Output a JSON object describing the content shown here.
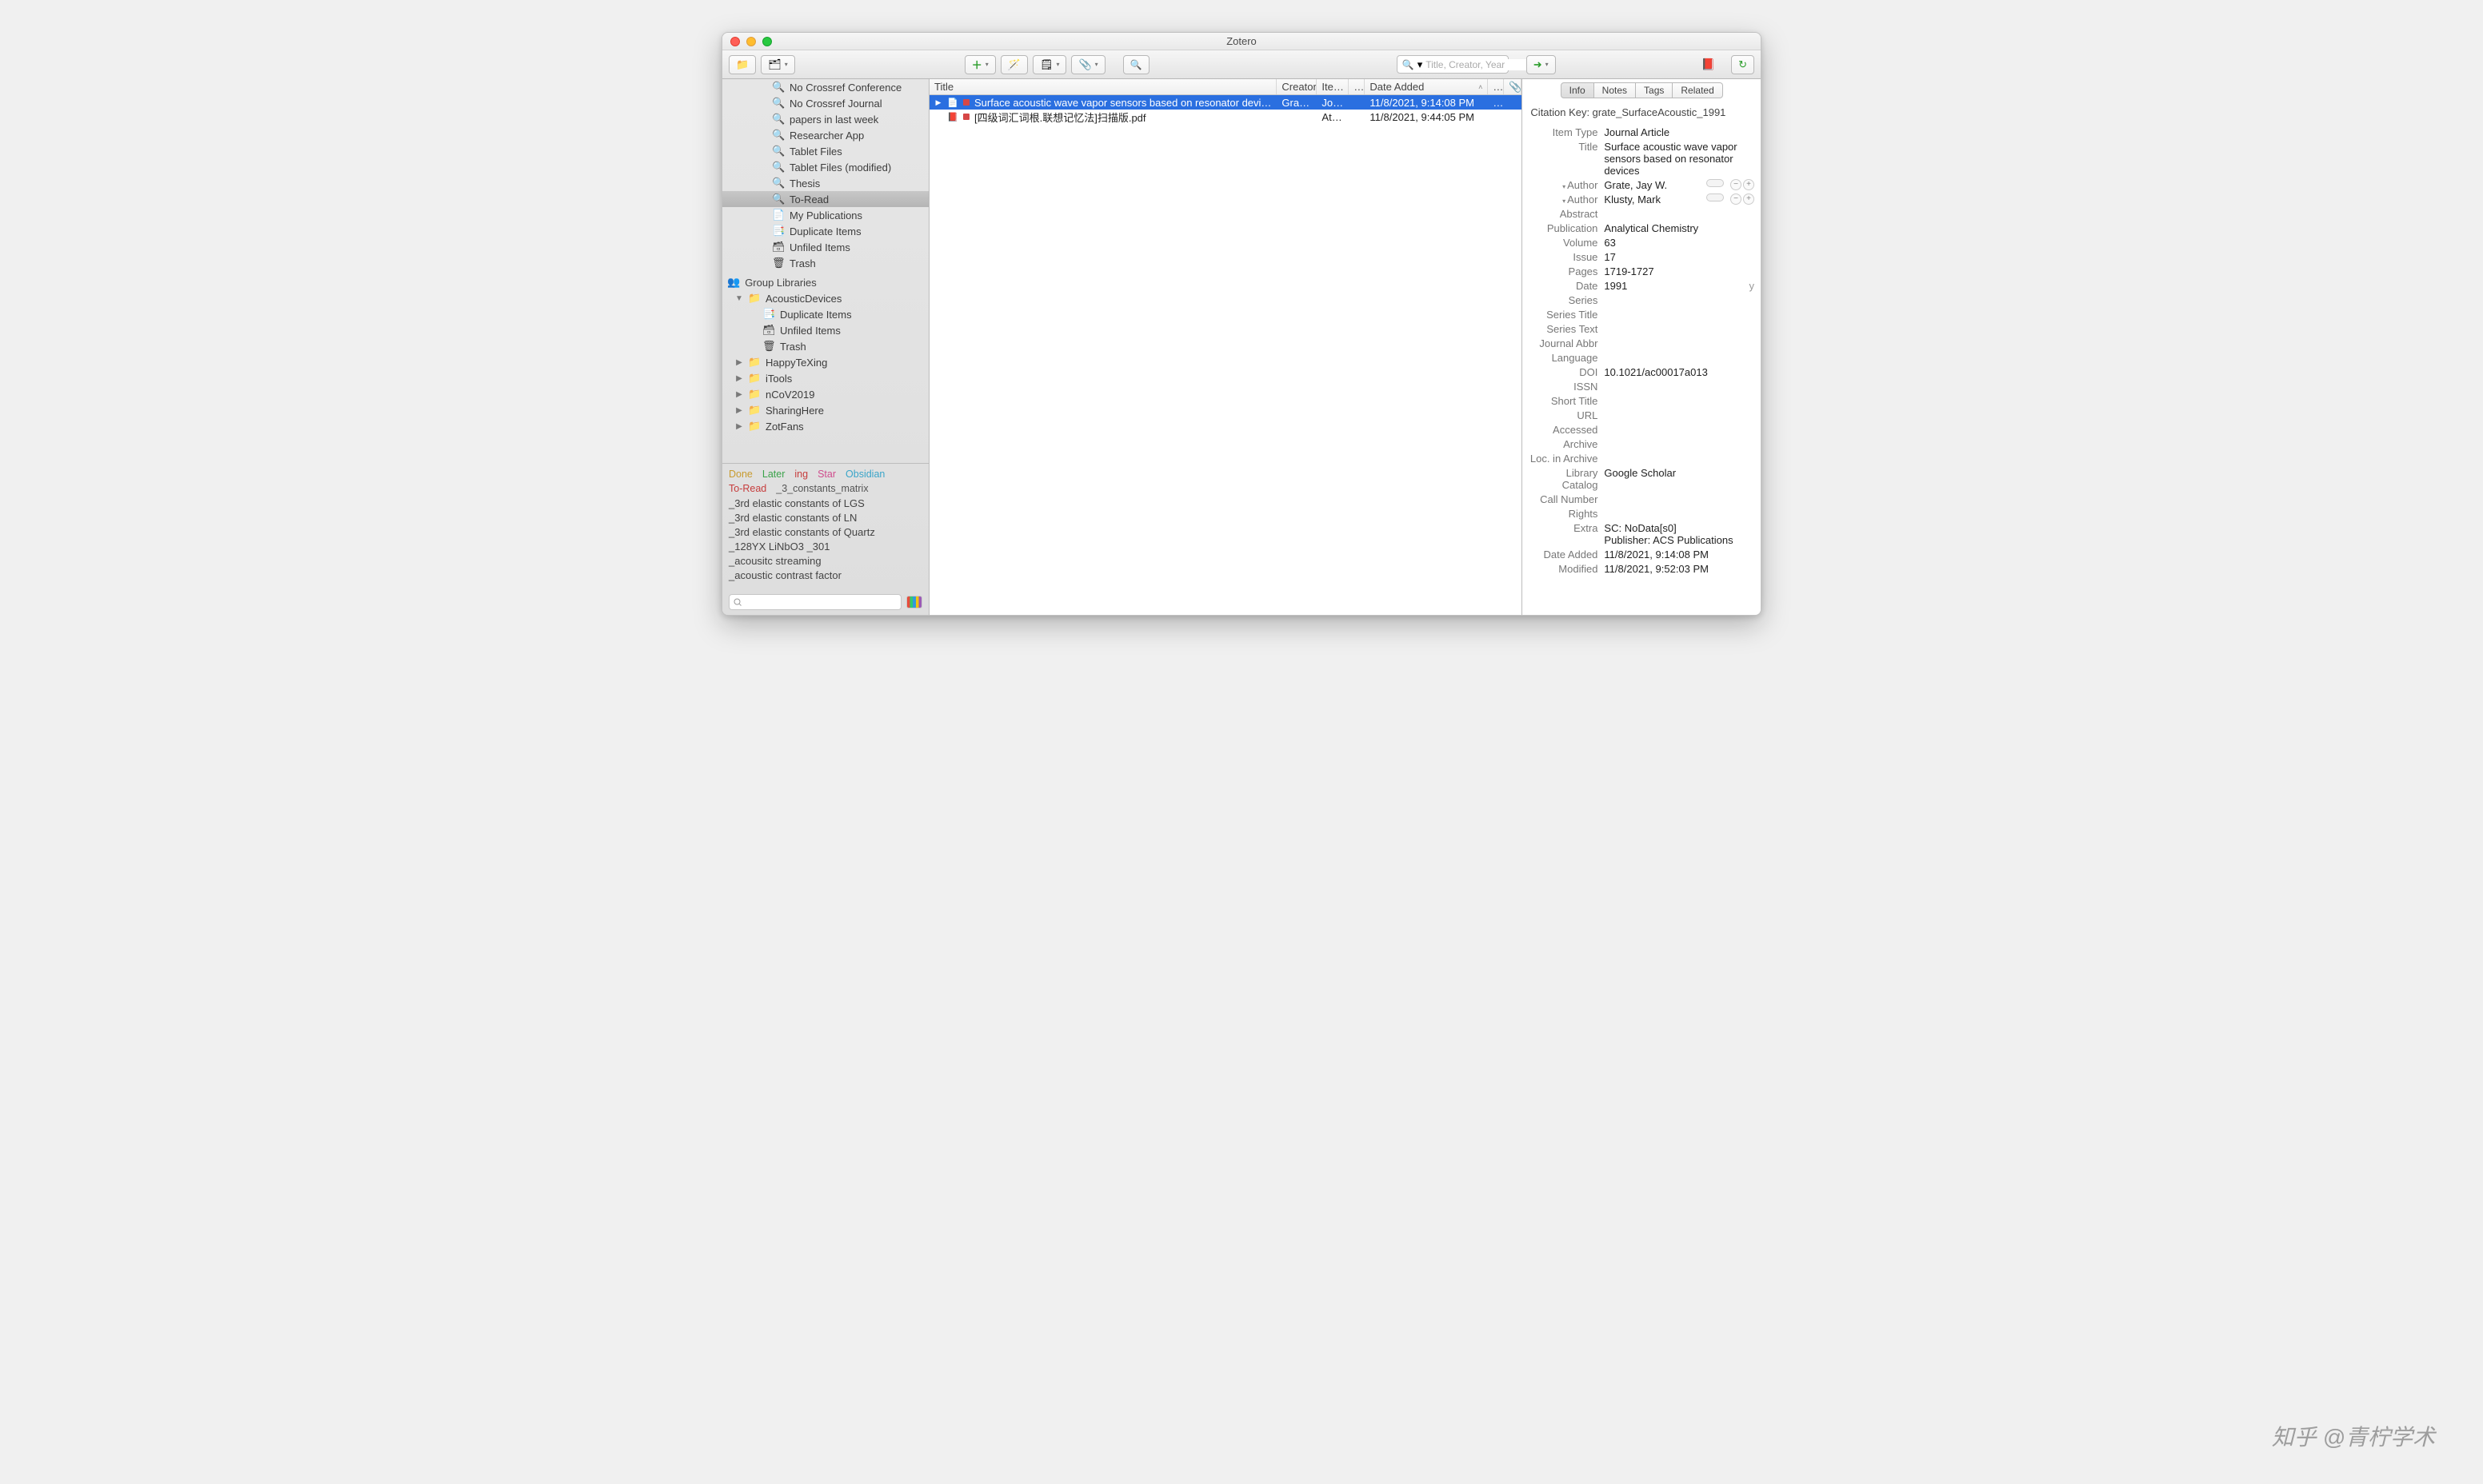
{
  "window": {
    "title": "Zotero"
  },
  "toolbar": {
    "search_placeholder": "Title, Creator, Year"
  },
  "sidebar": {
    "collections": [
      {
        "label": "No Crossref Conference",
        "icon": "search-folder",
        "indent": 1
      },
      {
        "label": "No Crossref Journal",
        "icon": "search-folder",
        "indent": 1
      },
      {
        "label": "papers in last week",
        "icon": "search-folder",
        "indent": 1
      },
      {
        "label": "Researcher App",
        "icon": "search-folder",
        "indent": 1
      },
      {
        "label": "Tablet Files",
        "icon": "search-folder",
        "indent": 1
      },
      {
        "label": "Tablet Files (modified)",
        "icon": "search-folder",
        "indent": 1
      },
      {
        "label": "Thesis",
        "icon": "search-folder",
        "indent": 1
      },
      {
        "label": "To-Read",
        "icon": "search-folder",
        "indent": 1,
        "selected": true
      },
      {
        "label": "My Publications",
        "icon": "page",
        "indent": 1
      },
      {
        "label": "Duplicate Items",
        "icon": "duplicate",
        "indent": 1
      },
      {
        "label": "Unfiled Items",
        "icon": "unfiled",
        "indent": 1
      },
      {
        "label": "Trash",
        "icon": "trash",
        "indent": 1
      }
    ],
    "group_header": "Group Libraries",
    "groups": [
      {
        "label": "AcousticDevices",
        "icon": "folder",
        "indent": 0,
        "expanded": true
      },
      {
        "label": "Duplicate Items",
        "icon": "duplicate",
        "indent": 1
      },
      {
        "label": "Unfiled Items",
        "icon": "unfiled",
        "indent": 1
      },
      {
        "label": "Trash",
        "icon": "trash",
        "indent": 1
      },
      {
        "label": "HappyTeXing",
        "icon": "folder",
        "indent": 0,
        "collapsed": true
      },
      {
        "label": "iTools",
        "icon": "folder",
        "indent": 0,
        "collapsed": true
      },
      {
        "label": "nCoV2019",
        "icon": "folder",
        "indent": 0,
        "collapsed": true
      },
      {
        "label": "SharingHere",
        "icon": "folder",
        "indent": 0,
        "collapsed": true
      },
      {
        "label": "ZotFans",
        "icon": "folder",
        "indent": 0,
        "collapsed": true
      }
    ],
    "tags_colored": [
      {
        "label": "Done",
        "color": "#c89b2f"
      },
      {
        "label": "Later",
        "color": "#3aa24a"
      },
      {
        "label": "ing",
        "color": "#c63c3c"
      },
      {
        "label": "Star",
        "color": "#cf4d8d"
      },
      {
        "label": "Obsidian",
        "color": "#3aa5c9"
      }
    ],
    "tags_row2": [
      {
        "label": "To-Read",
        "color": "#c63c3c"
      },
      {
        "label": "_3_constants_matrix",
        "color": "#555"
      }
    ],
    "tags_plain": [
      "_3rd elastic constants of LGS",
      "_3rd elastic constants of LN",
      "_3rd elastic constants of Quartz",
      "_128YX LiNbO3   _301",
      "_acousitc streaming",
      "_acoustic contrast factor"
    ]
  },
  "columns": {
    "title": "Title",
    "creator": "Creator",
    "itemtype": "Ite…",
    "misc1": "…",
    "date_added": "Date Added",
    "misc2": "…"
  },
  "items": [
    {
      "title": "Surface acoustic wave vapor sensors based on resonator devi…",
      "creator": "Grate …",
      "itemtype": "Jou…",
      "date": "11/8/2021, 9:14:08 PM",
      "icon": "doc",
      "selected": true,
      "has_tag": true,
      "expandable": true,
      "att": "…"
    },
    {
      "title": "[四级词汇词根.联想记忆法]扫描版.pdf",
      "creator": "",
      "itemtype": "Att…",
      "date": "11/8/2021, 9:44:05 PM",
      "icon": "pdf",
      "selected": false,
      "has_tag": true,
      "expandable": false,
      "att": ""
    }
  ],
  "info": {
    "tabs": [
      "Info",
      "Notes",
      "Tags",
      "Related"
    ],
    "active_tab": "Info",
    "citation_key_label": "Citation Key:",
    "citation_key": "grate_SurfaceAcoustic_1991",
    "fields": [
      {
        "label": "Item Type",
        "value": "Journal Article"
      },
      {
        "label": "Title",
        "value": "Surface acoustic wave vapor sensors based on resonator devices"
      },
      {
        "label": "Author",
        "value": "Grate, Jay W.",
        "caret": true,
        "author": true
      },
      {
        "label": "Author",
        "value": "Klusty, Mark",
        "caret": true,
        "author": true
      },
      {
        "label": "Abstract",
        "value": ""
      },
      {
        "label": "Publication",
        "value": "Analytical Chemistry"
      },
      {
        "label": "Volume",
        "value": "63"
      },
      {
        "label": "Issue",
        "value": "17"
      },
      {
        "label": "Pages",
        "value": "1719-1727"
      },
      {
        "label": "Date",
        "value": "1991",
        "trailing": "y"
      },
      {
        "label": "Series",
        "value": ""
      },
      {
        "label": "Series Title",
        "value": ""
      },
      {
        "label": "Series Text",
        "value": ""
      },
      {
        "label": "Journal Abbr",
        "value": ""
      },
      {
        "label": "Language",
        "value": ""
      },
      {
        "label": "DOI",
        "value": "10.1021/ac00017a013"
      },
      {
        "label": "ISSN",
        "value": ""
      },
      {
        "label": "Short Title",
        "value": ""
      },
      {
        "label": "URL",
        "value": ""
      },
      {
        "label": "Accessed",
        "value": ""
      },
      {
        "label": "Archive",
        "value": ""
      },
      {
        "label": "Loc. in Archive",
        "value": ""
      },
      {
        "label": "Library Catalog",
        "value": "Google Scholar"
      },
      {
        "label": "Call Number",
        "value": ""
      },
      {
        "label": "Rights",
        "value": ""
      },
      {
        "label": "Extra",
        "value": "SC: NoData[s0]\nPublisher: ACS Publications"
      },
      {
        "label": "Date Added",
        "value": "11/8/2021, 9:14:08 PM"
      },
      {
        "label": "Modified",
        "value": "11/8/2021, 9:52:03 PM"
      }
    ]
  },
  "watermark": "知乎 @青柠学术"
}
